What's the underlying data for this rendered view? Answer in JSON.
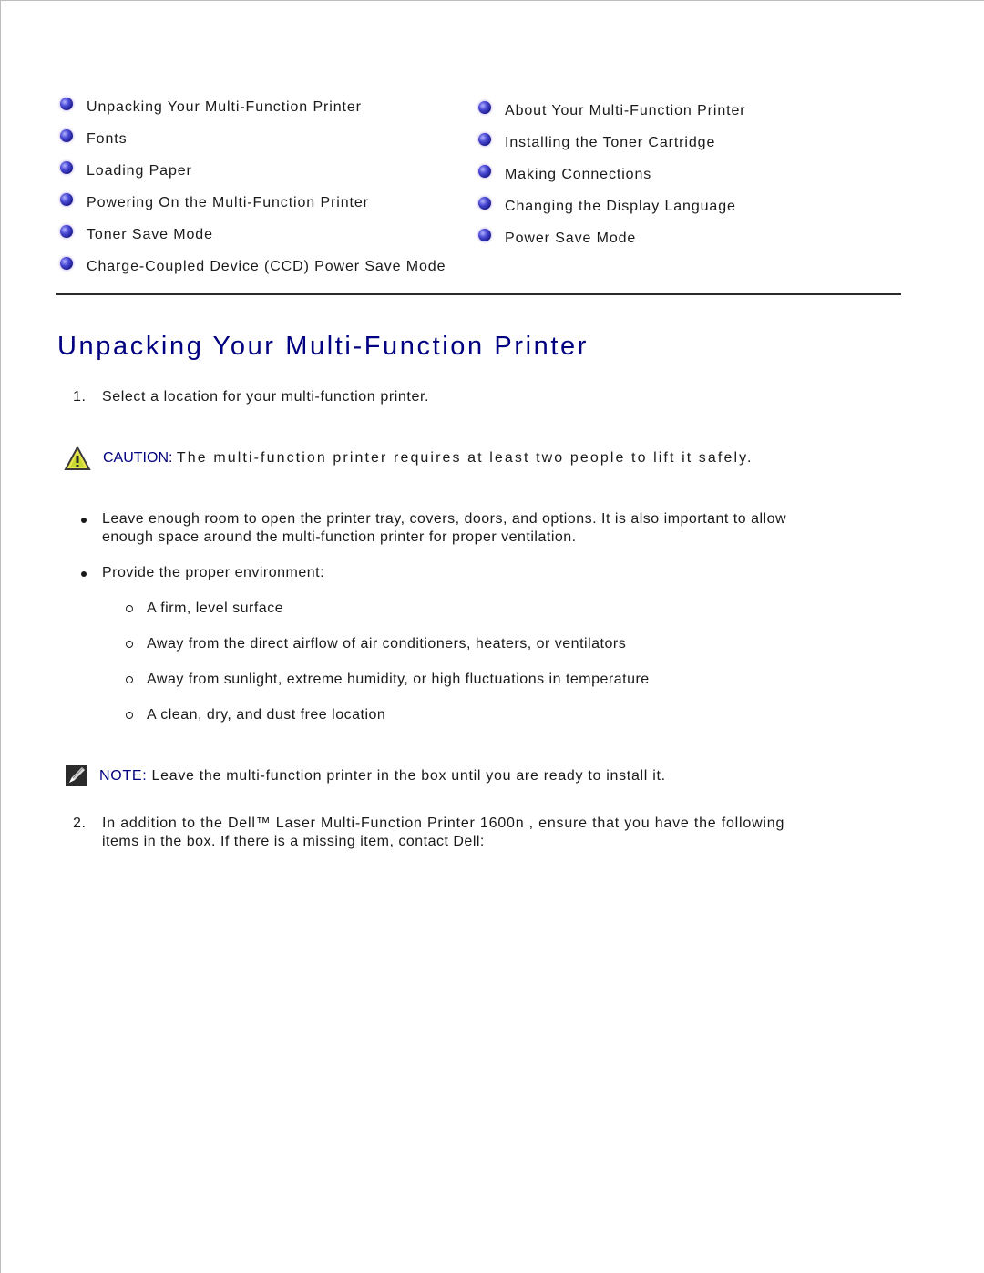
{
  "toc": {
    "left": [
      {
        "label": "Unpacking Your Multi-Function Printer",
        "icon": "blue-orb-bullet-icon"
      },
      {
        "label": "Fonts",
        "icon": "blue-orb-bullet-icon"
      },
      {
        "label": "Loading Paper",
        "icon": "blue-orb-bullet-icon"
      },
      {
        "label": "Powering On the Multi-Function Printer",
        "icon": "blue-orb-bullet-icon"
      },
      {
        "label": "Toner Save Mode",
        "icon": "blue-orb-bullet-icon"
      },
      {
        "label": "Charge-Coupled Device (CCD) Power Save Mode",
        "icon": "blue-orb-bullet-icon"
      }
    ],
    "right": [
      {
        "label": "About Your Multi-Function Printer",
        "icon": "blue-orb-bullet-icon"
      },
      {
        "label": "Installing the Toner Cartridge",
        "icon": "blue-orb-bullet-icon"
      },
      {
        "label": "Making Connections",
        "icon": "blue-orb-bullet-icon"
      },
      {
        "label": "Changing the Display Language",
        "icon": "blue-orb-bullet-icon"
      },
      {
        "label": "Power Save Mode",
        "icon": "blue-orb-bullet-icon"
      }
    ]
  },
  "section": {
    "title": "Unpacking Your Multi-Function Printer",
    "step1": {
      "num": "1.",
      "text": "Select a location for your multi-function printer."
    },
    "caution": {
      "icon": "warning-triangle-icon",
      "label": "CAUTION:",
      "text": "The multi-function printer requires at least two people to lift it safely."
    },
    "bullets": [
      {
        "line1": "Leave enough room to open the printer tray, covers, doors, and options. It is also important to allow",
        "line2": "enough space around the multi-function printer for proper ventilation."
      },
      {
        "line1": "Provide the proper environment:"
      }
    ],
    "sub_bullets": [
      "A firm, level surface",
      "Away from the direct airflow of air conditioners, heaters, or ventilators",
      "Away from sunlight, extreme humidity, or high fluctuations in temperature",
      "A clean, dry, and dust free location"
    ],
    "note": {
      "icon": "pencil-note-icon",
      "label": "NOTE:",
      "text": "Leave the multi-function printer in the box until you are ready to install it."
    },
    "step2": {
      "num": "2.",
      "line1": "In addition to the Dell™ Laser Multi-Function Printer 1600n , ensure that you have the following",
      "line2": "items in the box. If there is a missing item, contact Dell:"
    }
  },
  "colors": {
    "heading": "#000080",
    "label": "#000080",
    "text": "#1a1a1a",
    "rule": "#2a2a2a"
  }
}
